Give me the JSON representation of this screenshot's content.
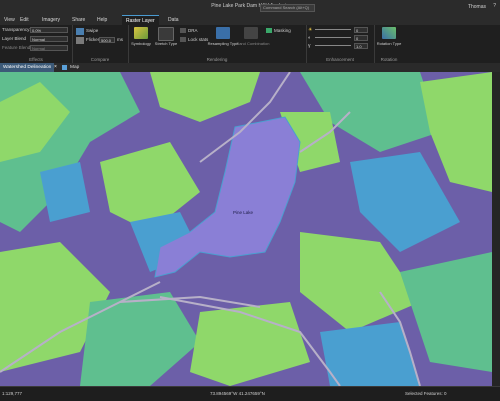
{
  "app": {
    "title": "Pine Lake Park Dam H&H Analysis",
    "search_placeholder": "Command Search (Alt+Q)",
    "user": "Thomas",
    "help_icon": "question-icon"
  },
  "menu": {
    "items": [
      "View",
      "Edit",
      "Imagery",
      "Share",
      "Help"
    ],
    "active_tab": "Raster Layer",
    "extra_tab": "Data"
  },
  "ribbon": {
    "effects": {
      "transparency_label": "Transparency:",
      "transparency_value": "0.0%",
      "layer_blend_label": "Layer Blend",
      "layer_blend_value": "Normal",
      "feature_blend_label": "Feature Blend",
      "feature_blend_value": "Normal",
      "group_label": "Effects"
    },
    "compare": {
      "swipe_label": "Swipe",
      "flicker_label": "Flicker",
      "flicker_value": "500.0",
      "flicker_unit": "ms",
      "group_label": "Compare"
    },
    "rendering": {
      "symbology_label": "Symbology",
      "stretch_type_label": "Stretch Type",
      "dra_label": "DRA",
      "lock_stats_label": "Lock stats",
      "resampling_type_label": "Resampling Type",
      "band_combination_label": "Band Combination",
      "masking_label": "Masking",
      "group_label": "Rendering"
    },
    "enhancement": {
      "values": [
        "0",
        "0",
        "1.0"
      ],
      "group_label": "Enhancement"
    },
    "rotation": {
      "rotation_type_label": "Rotation Type",
      "group_label": "Rotation"
    }
  },
  "tabs": {
    "items": [
      "Watershed Delineation",
      "Map"
    ]
  },
  "map": {
    "labels": [
      "Pine Lake"
    ],
    "colors": {
      "water": "#8a7fd6",
      "background": "#6c5fa8",
      "veg1": "#8fd86a",
      "veg2": "#5fbf8f",
      "veg3": "#4a9fd0"
    }
  },
  "status": {
    "scale": "1:129,777",
    "coords": "73.894569°W 41.247659°N",
    "selected_features": "Selected Features: 0"
  }
}
